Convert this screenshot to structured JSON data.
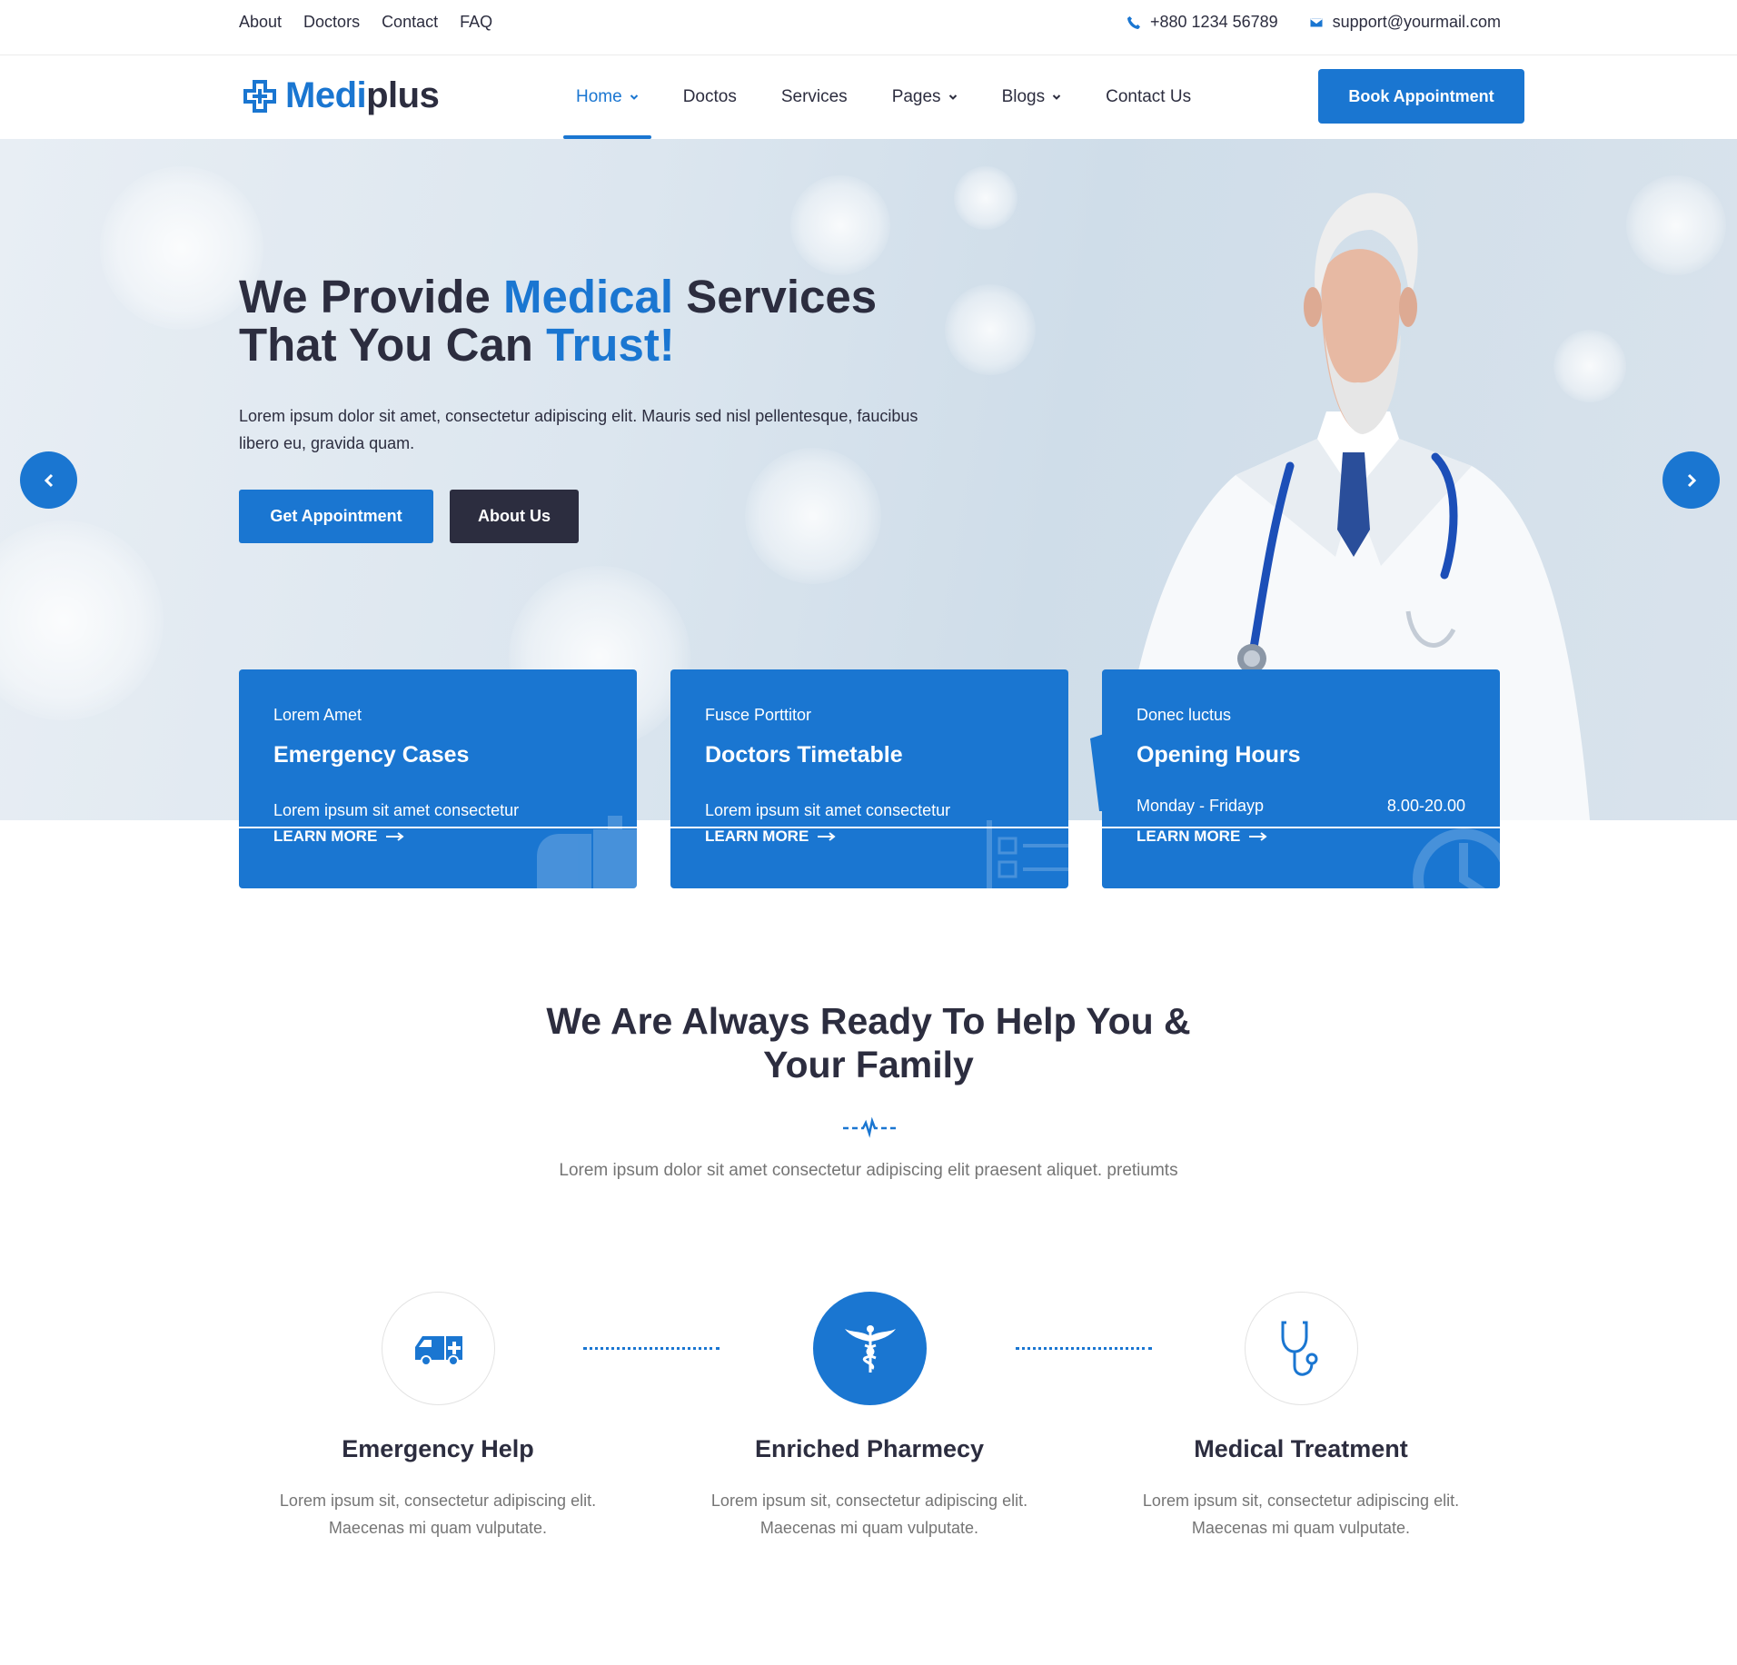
{
  "topbar": {
    "links": [
      "About",
      "Doctors",
      "Contact",
      "FAQ"
    ],
    "phone": "+880 1234 56789",
    "email": "support@yourmail.com",
    "phone_icon": "phone-icon",
    "email_icon": "envelope-icon"
  },
  "header": {
    "logo_medi": "Medi",
    "logo_plus": "plus",
    "nav": [
      {
        "label": "Home",
        "dropdown": true,
        "active": true
      },
      {
        "label": "Doctos",
        "dropdown": false
      },
      {
        "label": "Services",
        "dropdown": false
      },
      {
        "label": "Pages",
        "dropdown": true
      },
      {
        "label": "Blogs",
        "dropdown": true
      },
      {
        "label": "Contact Us",
        "dropdown": false
      }
    ],
    "book_button": "Book Appointment"
  },
  "hero": {
    "title_part1": "We Provide ",
    "title_highlight1": "Medical",
    "title_part2": " Services",
    "title_part3": "That You Can ",
    "title_highlight2": "Trust!",
    "text": "Lorem ipsum dolor sit amet, consectetur adipiscing elit. Mauris sed nisl pellentesque, faucibus libero eu, gravida quam.",
    "primary_button": "Get Appointment",
    "secondary_button": "About Us"
  },
  "cards": [
    {
      "sub": "Lorem Amet",
      "title": "Emergency Cases",
      "desc": "Lorem ipsum sit amet consectetur",
      "learn": "LEARN MORE"
    },
    {
      "sub": "Fusce Porttitor",
      "title": "Doctors Timetable",
      "desc": "Lorem ipsum sit amet consectetur",
      "learn": "LEARN MORE"
    },
    {
      "sub": "Donec luctus",
      "title": "Opening Hours",
      "days": "Monday - Fridayp",
      "time": "8.00-20.00",
      "learn": "LEARN MORE"
    }
  ],
  "section": {
    "title_line1": "We Are Always Ready To Help You &",
    "title_line2": "Your Family",
    "text": "Lorem ipsum dolor sit amet consectetur adipiscing elit praesent aliquet. pretiumts"
  },
  "features": [
    {
      "title": "Emergency Help",
      "text_line1": "Lorem ipsum sit, consectetur adipiscing elit.",
      "text_line2": "Maecenas mi quam vulputate.",
      "icon": "ambulance-icon"
    },
    {
      "title": "Enriched Pharmecy",
      "text_line1": "Lorem ipsum sit, consectetur adipiscing elit.",
      "text_line2": "Maecenas mi quam vulputate.",
      "icon": "caduceus-icon"
    },
    {
      "title": "Medical Treatment",
      "text_line1": "Lorem ipsum sit, consectetur adipiscing elit.",
      "text_line2": "Maecenas mi quam vulputate.",
      "icon": "stethoscope-icon"
    }
  ],
  "colors": {
    "accent": "#1a76d1",
    "dark": "#2c2d3f",
    "muted": "#757575"
  }
}
